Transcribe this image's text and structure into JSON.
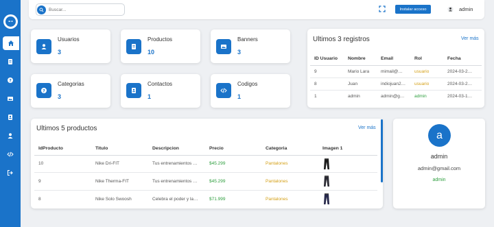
{
  "search": {
    "placeholder": "Buscar..."
  },
  "topbar": {
    "install_label": "Instalar acceso",
    "user_name": "admin"
  },
  "sidebar": {
    "logo_text": "•◦•",
    "items": [
      {
        "icon": "home-icon"
      },
      {
        "icon": "book-icon"
      },
      {
        "icon": "help-icon"
      },
      {
        "icon": "image-icon"
      },
      {
        "icon": "contact-card-icon"
      },
      {
        "icon": "user-icon"
      },
      {
        "icon": "code-icon"
      },
      {
        "icon": "logout-icon"
      }
    ]
  },
  "stats": [
    {
      "title": "Usuarios",
      "value": "3",
      "icon": "user-icon"
    },
    {
      "title": "Productos",
      "value": "10",
      "icon": "book-icon"
    },
    {
      "title": "Banners",
      "value": "3",
      "icon": "image-icon"
    },
    {
      "title": "Categorias",
      "value": "3",
      "icon": "help-icon"
    },
    {
      "title": "Contactos",
      "value": "1",
      "icon": "contact-card-icon"
    },
    {
      "title": "Codigos",
      "value": "1",
      "icon": "code-icon"
    }
  ],
  "registros": {
    "title": "Ultimos 3 registros",
    "link": "Ver más",
    "headers": [
      "ID Usuario",
      "Nombre",
      "Email",
      "Rol",
      "Fecha"
    ],
    "rows": [
      [
        "9",
        "Mario Lara",
        "mimail@…",
        "usuario",
        "2024-03-2…"
      ],
      [
        "8",
        "Juan",
        "indiojuan2…",
        "usuario",
        "2024-03-2…"
      ],
      [
        "1",
        "admin",
        "admin@g…",
        "admin",
        "2024-03-1…"
      ]
    ]
  },
  "productos": {
    "title": "Ultimos 5 productos",
    "link": "Ver más",
    "headers": [
      "IdProducto",
      "Titulo",
      "Descripcion",
      "Precio",
      "Categoria",
      "Imagen 1"
    ],
    "rows": [
      [
        "10",
        "Nike Dri-FIT",
        "Tus entrenamientos …",
        "$45.299",
        "Pantalones"
      ],
      [
        "9",
        "Nike Therma-FIT",
        "Tus entrenamientos …",
        "$45.299",
        "Pantalones"
      ],
      [
        "8",
        "Nike Solo Swoosh",
        "Celebra el poder y la…",
        "$71.999",
        "Pantalones"
      ]
    ]
  },
  "profile": {
    "avatar_letter": "a",
    "name": "admin",
    "email": "admin@gmail.com",
    "role": "admin"
  },
  "colors": {
    "primary": "#1a73c9",
    "user_role": "#d4a017",
    "admin_role": "#2e9e3e"
  }
}
